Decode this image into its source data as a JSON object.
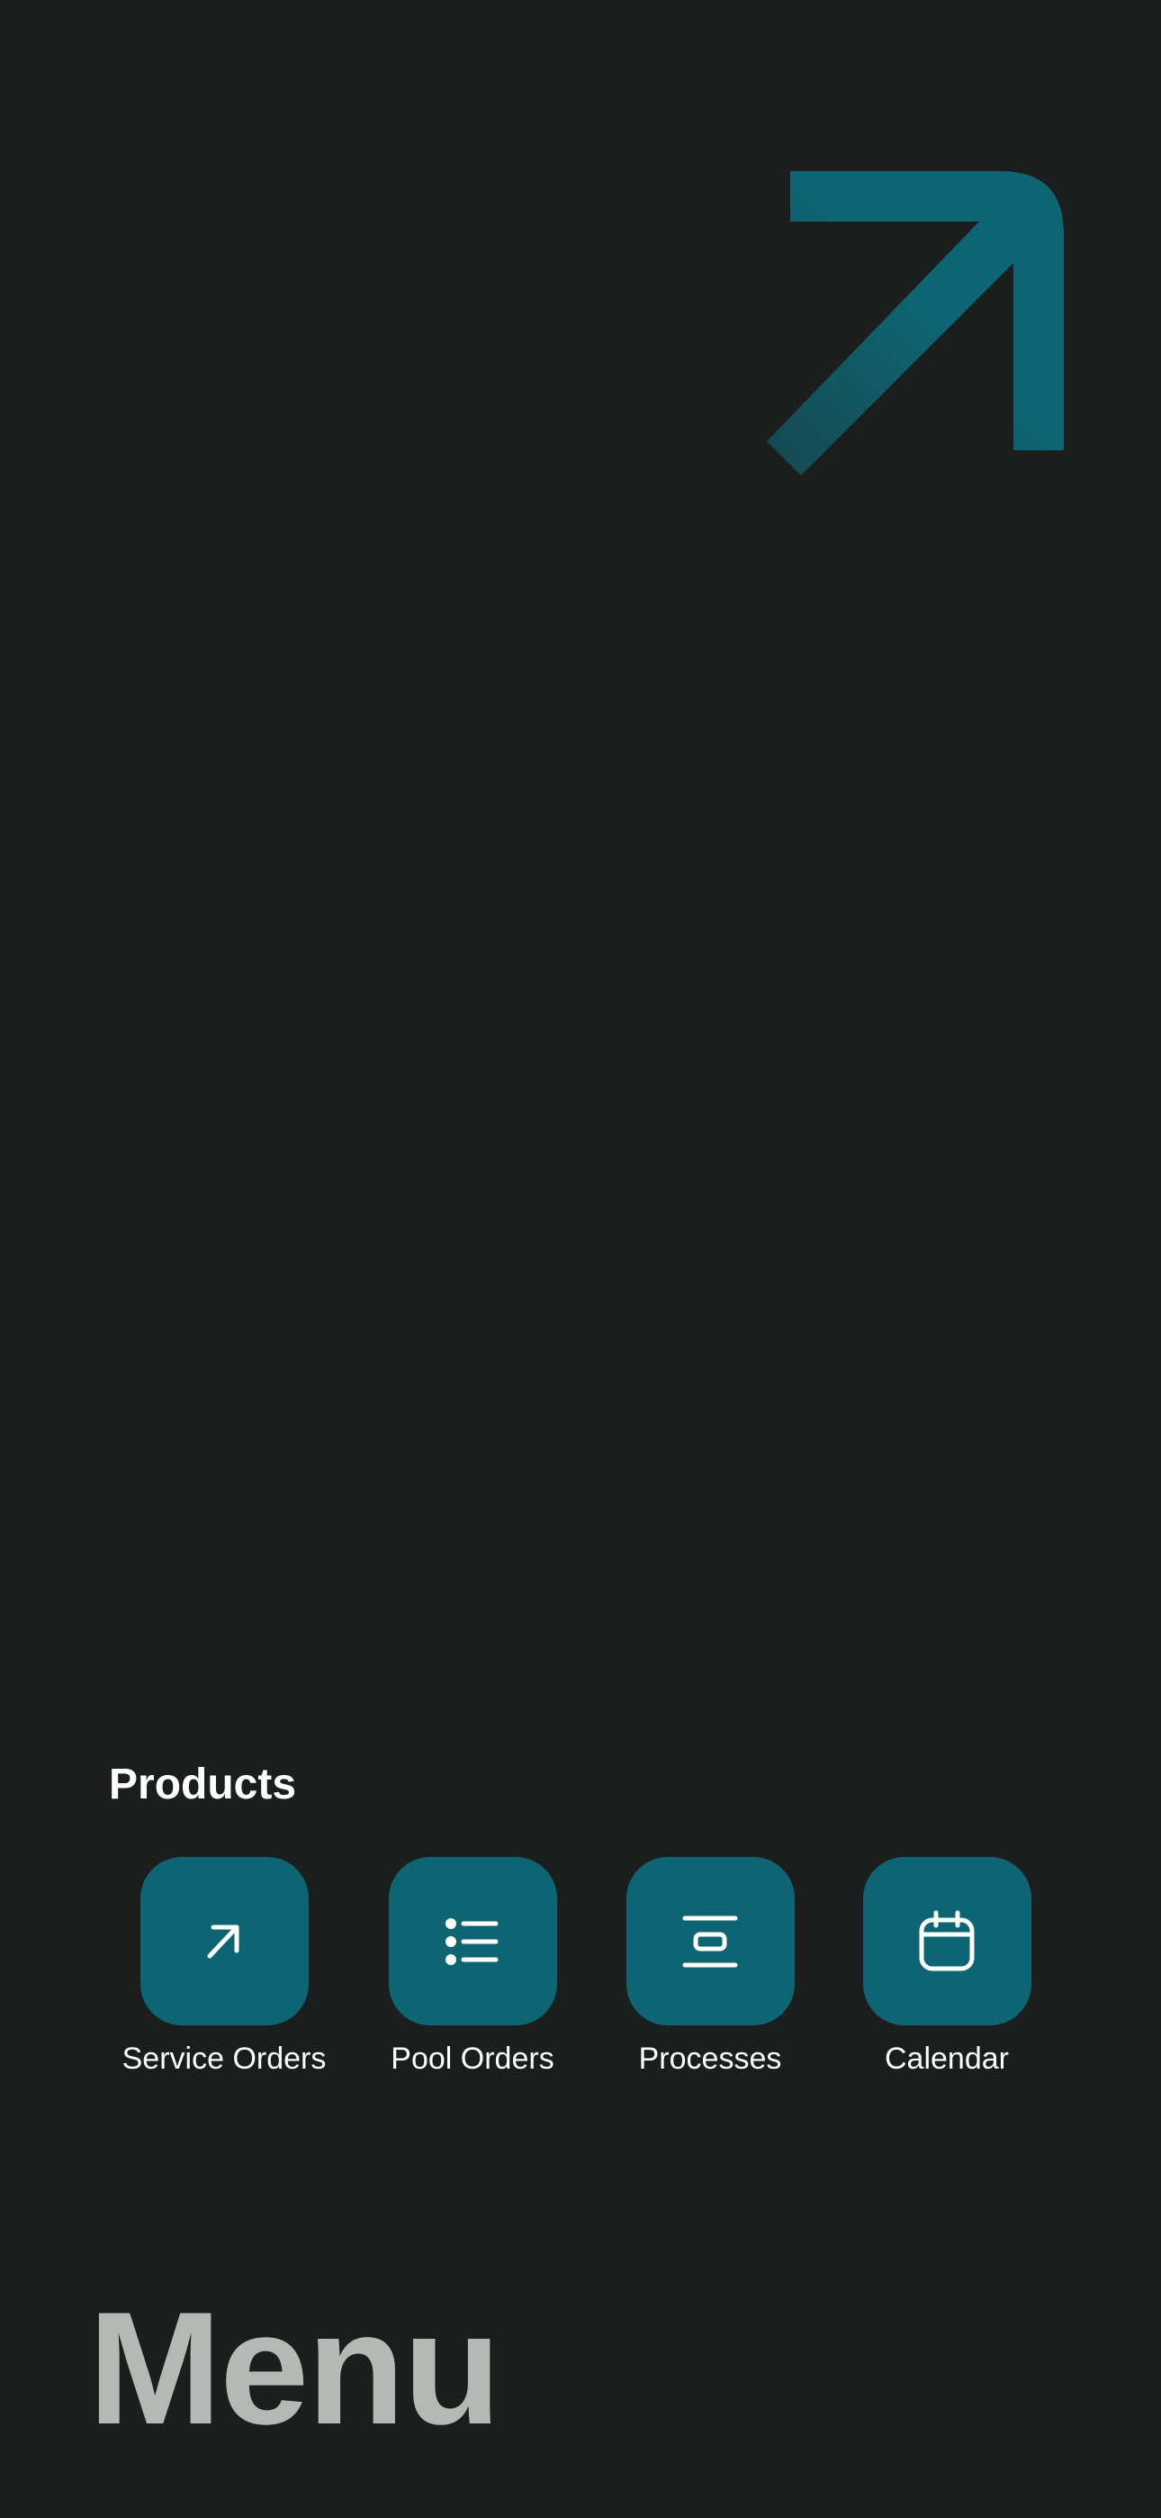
{
  "theme": {
    "background": "#1b1e1c",
    "accent": "#0d6573",
    "accent_fade": "#16474f",
    "text": "#ffffff",
    "menu_text": "#b5b9b6"
  },
  "hero": {
    "icon": "arrow-up-right-icon"
  },
  "products": {
    "title": "Products",
    "items": [
      {
        "label": "Service Orders",
        "icon": "arrow-up-right-icon"
      },
      {
        "label": "Pool Orders",
        "icon": "list-icon"
      },
      {
        "label": "Processes",
        "icon": "align-center-icon"
      },
      {
        "label": "Calendar",
        "icon": "calendar-icon"
      }
    ]
  },
  "menu": {
    "title": "Menu"
  }
}
